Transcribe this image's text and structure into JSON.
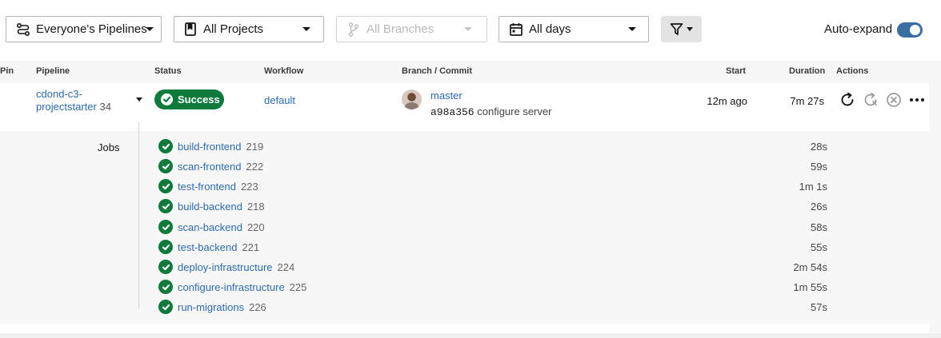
{
  "filters": {
    "pipelines_scope": "Everyone's Pipelines",
    "projects": "All Projects",
    "branches": "All Branches",
    "days": "All days",
    "auto_expand_label": "Auto-expand",
    "auto_expand_on": true
  },
  "columns": {
    "pin": "Pin",
    "pipeline": "Pipeline",
    "status": "Status",
    "workflow": "Workflow",
    "branch_commit": "Branch / Commit",
    "start": "Start",
    "duration": "Duration",
    "actions": "Actions"
  },
  "pipeline": {
    "name": "cdond-c3-projectstarter",
    "number": "34",
    "status": "Success",
    "workflow": "default",
    "branch": "master",
    "commit_sha": "a98a356",
    "commit_message": "configure server",
    "start": "12m ago",
    "duration": "7m 27s"
  },
  "jobs_label": "Jobs",
  "jobs": [
    {
      "name": "build-frontend",
      "number": "219",
      "duration": "28s"
    },
    {
      "name": "scan-frontend",
      "number": "222",
      "duration": "59s"
    },
    {
      "name": "test-frontend",
      "number": "223",
      "duration": "1m 1s"
    },
    {
      "name": "build-backend",
      "number": "218",
      "duration": "26s"
    },
    {
      "name": "scan-backend",
      "number": "220",
      "duration": "58s"
    },
    {
      "name": "test-backend",
      "number": "221",
      "duration": "55s"
    },
    {
      "name": "deploy-infrastructure",
      "number": "224",
      "duration": "2m 54s"
    },
    {
      "name": "configure-infrastructure",
      "number": "225",
      "duration": "1m 55s"
    },
    {
      "name": "run-migrations",
      "number": "226",
      "duration": "57s"
    }
  ],
  "colors": {
    "success": "#0e7a3c",
    "link": "#2c6bb0",
    "toggle": "#3b6ea3"
  },
  "icons": [
    "pipelines-icon",
    "project-icon",
    "branch-icon",
    "calendar-icon",
    "filter-icon",
    "rerun-icon",
    "rerun-failed-icon",
    "cancel-icon",
    "more-icon",
    "success-check-icon"
  ]
}
